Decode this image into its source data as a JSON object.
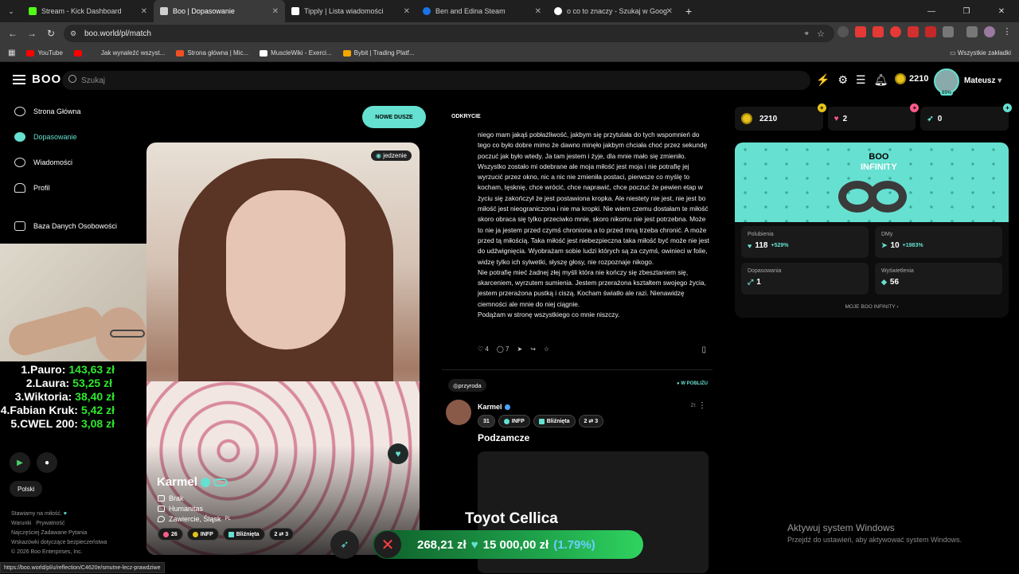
{
  "browser": {
    "tabs": [
      {
        "label": "Stream - Kick Dashboard",
        "color": "#53fc18"
      },
      {
        "label": "Boo | Dopasowanie",
        "color": "#d0d0d0"
      },
      {
        "label": "Tipply | Lista wiadomości",
        "color": "#ffffff"
      },
      {
        "label": "Ben and Edina Steam",
        "color": "#1b73e8"
      },
      {
        "label": "o co to znaczy - Szukaj w Goog",
        "color": "#ffffff"
      }
    ],
    "url": "boo.world/pl/match",
    "bookmarks": [
      {
        "label": "YouTube",
        "color": "#ff0000"
      },
      {
        "label": "",
        "color": "#ff0000"
      },
      {
        "label": "Jak wynaleźć wszyst...",
        "color": "#3a3a3a"
      },
      {
        "label": "Strona główna | Mic...",
        "color": "#f25022"
      },
      {
        "label": "MuscleWiki - Exerci...",
        "color": "#ffffff"
      },
      {
        "label": "Bybit | Trading Platf...",
        "color": "#f7a600"
      }
    ],
    "bookmarks_right": "Wszystkie zakładki"
  },
  "app": {
    "logo": "BOO",
    "search_placeholder": "Szukaj",
    "coins": "2210",
    "user": "Mateusz",
    "avatar_pct": "89%",
    "nav": [
      {
        "label": "Strona Główna"
      },
      {
        "label": "Dopasowanie"
      },
      {
        "label": "Wiadomości"
      },
      {
        "label": "Profil"
      },
      {
        "label": "Baza Danych Osobowości"
      }
    ],
    "nowe_dusze": "NOWE DUSZE",
    "lang": "Polski",
    "footer": {
      "line1": "Stawiamy na miłość.",
      "link1": "Warunki",
      "link2": "Prywatność",
      "line3": "Najczęściej Zadawane Pytania",
      "line4": "Wskazówki dotyczące bezpieczeństwa",
      "line5": "© 2026 Boo Enterprises, Inc."
    }
  },
  "leaderboard": [
    {
      "name": "1.Pauro:",
      "value": "143,63 zł"
    },
    {
      "name": "2.Laura:",
      "value": "53,25 zł"
    },
    {
      "name": "3.Wiktoria:",
      "value": "38,40 zł"
    },
    {
      "name": "4.Fabian Kruk:",
      "value": "5,42 zł"
    },
    {
      "name": "5.CWEL 200:",
      "value": "3,08 zł"
    }
  ],
  "profile": {
    "tag": "jedzenie",
    "name": "Karmel",
    "info": [
      "Brak",
      "Humanitas",
      "Zawiercie, Śląsk"
    ],
    "country": "PL",
    "pills": [
      "26",
      "INFP",
      "Bliźnięta",
      "2 ⇄ 3"
    ]
  },
  "feed": {
    "header": "ODKRYCIE",
    "post_text": "niego mam jakąś pobłażliwość, jakbym się przytulała do tych wspomnień do tego co było dobre mimo że dawno minęło jakbym chciała choć przez sekundę poczuć jak było wtedy. Ja tam jestem i żyje, dla mnie mało się zmieniło. Wszystko zostało mi odebrane ale moja miłość jest moja i nie potrafię jej wyrzucić przez okno, nic a nic nie zmieniła postaci, pierwsze co myślę to kocham, tęsknię, chce wrócić, chce naprawić, chce poczuć że pewien etap w życiu się zakończył że jest postawiona kropka. Ale niestety nie jest, nie jest bo miłość jest nieograniczona i nie ma kropki. Nie wiem czemu dostałam te miłość skoro obraca się tylko przeciwko mnie, skoro nikomu nie jest potrzebna. Może to nie ja jestem przed czymś chroniona a to przed mną trzeba chronić. A może przed tą miłością. Taka miłość jest niebezpieczna taka miłość być może nie jest do udźwignięcia. Wyobrażam sobie ludzi których są za czymś, owinieci w folie, widzę tylko ich sylwetki, słyszę głosy, nie rozpoznaje nikogo.\nNie potrafię mieć żadnej złej myśli która nie kończy się zbesztaniem się, skarceniem, wyrzutem sumienia. Jestem przerażona kształtem swojego życia, jestem przerażona pustką i ciszą. Kocham światło ale razi. Nienawidzę ciemności ale mnie do niej ciągnie.\nPodążam w stronę wszystkiego co mnie niszczy.",
    "likes": "4",
    "comments": "7",
    "post2": {
      "tag": "przyroda",
      "near": "W POBLIŻU",
      "name": "Karmel",
      "time": "2г.",
      "pills": [
        "31",
        "INFP",
        "Bliźnięta",
        "2 ⇄ 3"
      ],
      "title": "Podzamcze"
    }
  },
  "stats": [
    {
      "value": "2210",
      "plus_color": "#e6c21a"
    },
    {
      "value": "2",
      "plus_color": "#ff5c8a"
    },
    {
      "value": "0",
      "plus_color": "#66e0d0"
    }
  ],
  "infinity": {
    "title": "BOO",
    "subtitle": "INFINITY",
    "boxes": [
      {
        "label": "Polubienia",
        "value": "118",
        "delta": "+529%"
      },
      {
        "label": "DMy",
        "value": "10",
        "delta": "+1983%"
      },
      {
        "label": "Dopasowania",
        "value": "1",
        "delta": ""
      },
      {
        "label": "Wyświetlenia",
        "value": "56",
        "delta": ""
      }
    ],
    "link": "MOJE BOO INFINITY"
  },
  "overlay": {
    "stream_title": "Toyot Cellica",
    "donation_current": "268,21 zł",
    "donation_goal": "15 000,00 zł",
    "donation_pct": "(1.79%)",
    "activate_title": "Aktywuj system Windows",
    "activate_sub": "Przejdź do ustawień, aby aktywować system Windows.",
    "status_url": "https://boo.world/pl/u/reflection/C4620e/smutne-lecz-prawdziwe"
  }
}
